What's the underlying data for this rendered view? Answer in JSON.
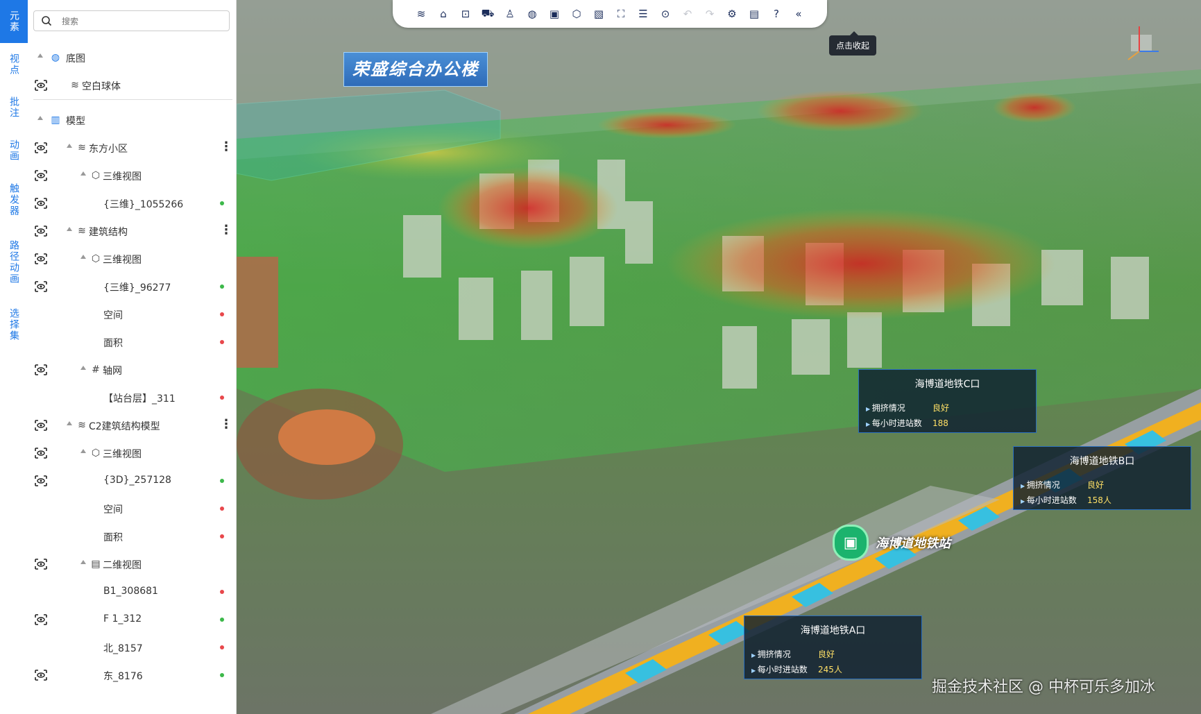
{
  "rail": {
    "tabs": [
      {
        "label": "元素",
        "active": true
      },
      {
        "label": "视点",
        "active": false
      },
      {
        "label": "批注",
        "active": false
      },
      {
        "label": "动画",
        "active": false
      },
      {
        "label": "触发器",
        "active": false
      },
      {
        "label": "路径动画",
        "active": false
      },
      {
        "label": "选择集",
        "active": false
      }
    ]
  },
  "search": {
    "placeholder": "搜索",
    "value": ""
  },
  "tree": {
    "basemap_label": "底图",
    "blank_globe_label": "空白球体",
    "model_label": "模型",
    "nodes": [
      {
        "label": "东方小区",
        "status": "more"
      },
      {
        "label": "三维视图",
        "status": ""
      },
      {
        "label": "{三维}_1055266",
        "status": "green"
      },
      {
        "label": "建筑结构",
        "status": "more"
      },
      {
        "label": "三维视图",
        "status": ""
      },
      {
        "label": "{三维}_96277",
        "status": "green"
      },
      {
        "label": "空间",
        "status": "red"
      },
      {
        "label": "面积",
        "status": "red"
      },
      {
        "label": "轴网",
        "status": ""
      },
      {
        "label": "【站台层】_311",
        "status": "red"
      },
      {
        "label": "C2建筑结构模型",
        "status": "more"
      },
      {
        "label": "三维视图",
        "status": ""
      },
      {
        "label": "{3D}_257128",
        "status": "green"
      },
      {
        "label": "空间",
        "status": "red"
      },
      {
        "label": "面积",
        "status": "red"
      },
      {
        "label": "二维视图",
        "status": ""
      },
      {
        "label": "B1_308681",
        "status": "red"
      },
      {
        "label": "F 1_312",
        "status": "green"
      },
      {
        "label": "北_8157",
        "status": "red"
      },
      {
        "label": "东_8176",
        "status": "green"
      }
    ]
  },
  "toolbar": {
    "icons": [
      "layers-icon",
      "home-icon",
      "measure-icon",
      "car-icon",
      "walk-icon",
      "globe-icon",
      "frame-icon",
      "cube-icon",
      "map-icon",
      "fullscreen-icon",
      "filter-icon",
      "search-icon",
      "undo-icon",
      "redo-icon",
      "settings-icon",
      "screen-icon",
      "help-icon",
      "collapse-icon"
    ],
    "tooltip": "点击收起"
  },
  "scene": {
    "building_label": "荣盛综合办公楼",
    "station_label": "海博道地铁站",
    "cards": [
      {
        "title": "海博道地铁C口",
        "k1": "拥挤情况",
        "v1": "良好",
        "k2": "每小时进站数",
        "v2": "188"
      },
      {
        "title": "海博道地铁B口",
        "k1": "拥挤情况",
        "v1": "良好",
        "k2": "每小时进站数",
        "v2": "158人"
      },
      {
        "title": "海博道地铁A口",
        "k1": "拥挤情况",
        "v1": "良好",
        "k2": "每小时进站数",
        "v2": "245人"
      }
    ],
    "watermark": "掘金技术社区 @ 中杯可乐多加冰"
  },
  "colors": {
    "accent": "#1e78e6",
    "dot_green": "#3cb84a",
    "dot_red": "#e8474b"
  }
}
